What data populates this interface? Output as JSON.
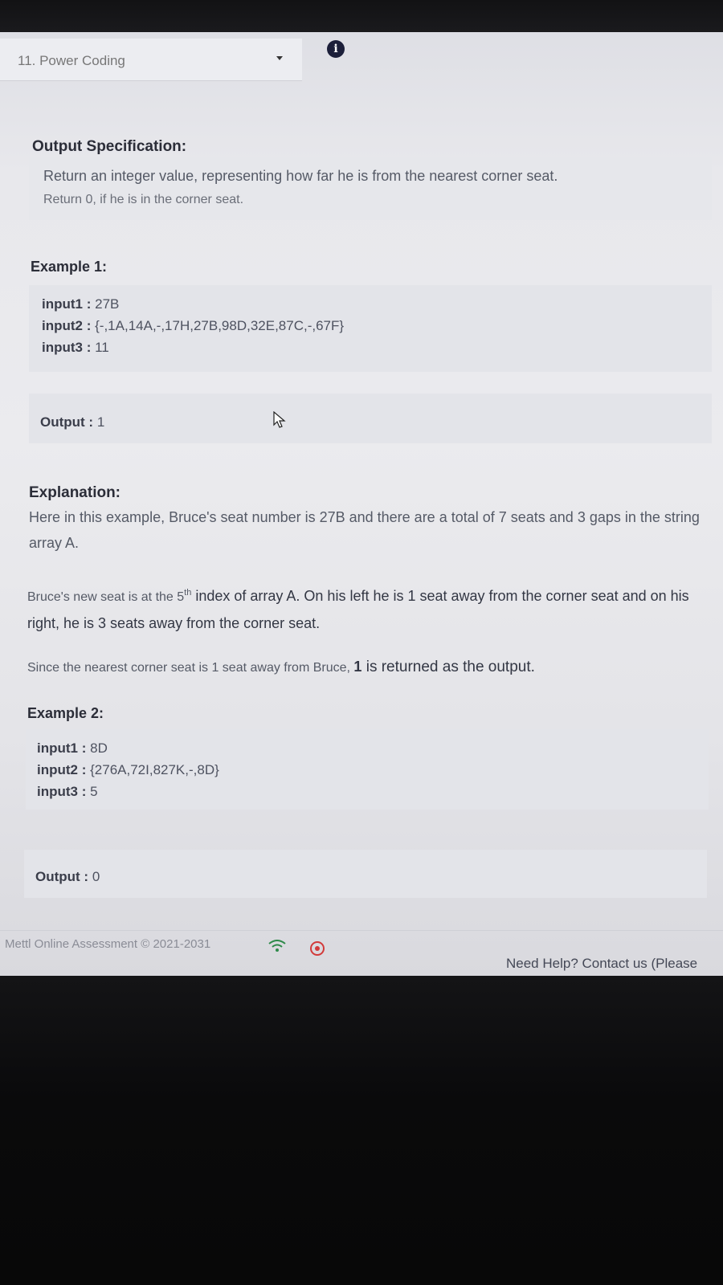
{
  "header": {
    "question_title": "11. Power Coding",
    "dropdown_icon": "chevron-down-icon",
    "info_icon": "info-icon",
    "info_glyph": "i"
  },
  "output_spec": {
    "heading": "Output Specification:",
    "line1": "Return an integer value, representing how far he is from the nearest corner seat.",
    "line2": "Return 0, if he is in the corner seat."
  },
  "example1": {
    "heading": "Example 1:",
    "input1_label": "input1 :",
    "input1_value": " 27B",
    "input2_label": "input2 :",
    "input2_value": " {-,1A,14A,-,17H,27B,98D,32E,87C,-,67F}",
    "input3_label": "input3 :",
    "input3_value": " 11",
    "output_label": "Output :",
    "output_value": " 1"
  },
  "explanation": {
    "heading": "Explanation:",
    "p1": "Here in this example, Bruce's seat number is 27B and there are a total of 7 seats and 3 gaps in the string array A.",
    "p2_before": "Bruce's new seat is at the 5",
    "p2_sup": "th",
    "p2_after": " index of array A. On his left he is 1 seat away from the corner seat and on his right, he is 3 seats away from the corner seat.",
    "p3_before": "Since the nearest corner seat is 1 seat away from Bruce, ",
    "p3_bold": "1",
    "p3_after": " is returned as the output."
  },
  "example2": {
    "heading": "Example 2:",
    "input1_label": "input1 :",
    "input1_value": " 8D",
    "input2_label": "input2 :",
    "input2_value": " {276A,72I,827K,-,8D}",
    "input3_label": "input3 :",
    "input3_value": " 5",
    "output_label": "Output :",
    "output_value": " 0"
  },
  "footer": {
    "copyright": "Mettl Online Assessment © 2021-2031",
    "wifi_icon": "wifi-icon",
    "record_icon": "recording-icon",
    "help_text": "Need Help? Contact us (Please"
  }
}
